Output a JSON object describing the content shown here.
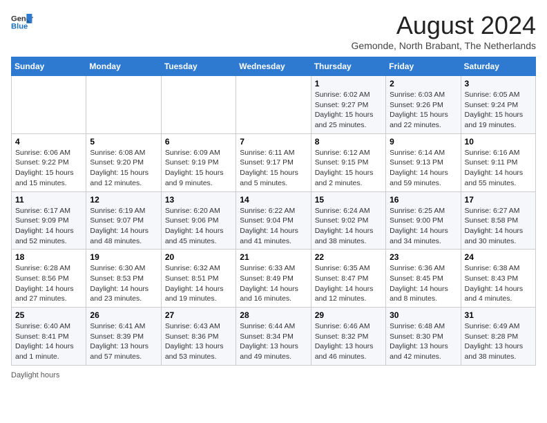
{
  "header": {
    "logo_line1": "General",
    "logo_line2": "Blue",
    "month_year": "August 2024",
    "location": "Gemonde, North Brabant, The Netherlands"
  },
  "weekdays": [
    "Sunday",
    "Monday",
    "Tuesday",
    "Wednesday",
    "Thursday",
    "Friday",
    "Saturday"
  ],
  "footer_text": "Daylight hours",
  "weeks": [
    [
      {
        "day": "",
        "info": ""
      },
      {
        "day": "",
        "info": ""
      },
      {
        "day": "",
        "info": ""
      },
      {
        "day": "",
        "info": ""
      },
      {
        "day": "1",
        "info": "Sunrise: 6:02 AM\nSunset: 9:27 PM\nDaylight: 15 hours\nand 25 minutes."
      },
      {
        "day": "2",
        "info": "Sunrise: 6:03 AM\nSunset: 9:26 PM\nDaylight: 15 hours\nand 22 minutes."
      },
      {
        "day": "3",
        "info": "Sunrise: 6:05 AM\nSunset: 9:24 PM\nDaylight: 15 hours\nand 19 minutes."
      }
    ],
    [
      {
        "day": "4",
        "info": "Sunrise: 6:06 AM\nSunset: 9:22 PM\nDaylight: 15 hours\nand 15 minutes."
      },
      {
        "day": "5",
        "info": "Sunrise: 6:08 AM\nSunset: 9:20 PM\nDaylight: 15 hours\nand 12 minutes."
      },
      {
        "day": "6",
        "info": "Sunrise: 6:09 AM\nSunset: 9:19 PM\nDaylight: 15 hours\nand 9 minutes."
      },
      {
        "day": "7",
        "info": "Sunrise: 6:11 AM\nSunset: 9:17 PM\nDaylight: 15 hours\nand 5 minutes."
      },
      {
        "day": "8",
        "info": "Sunrise: 6:12 AM\nSunset: 9:15 PM\nDaylight: 15 hours\nand 2 minutes."
      },
      {
        "day": "9",
        "info": "Sunrise: 6:14 AM\nSunset: 9:13 PM\nDaylight: 14 hours\nand 59 minutes."
      },
      {
        "day": "10",
        "info": "Sunrise: 6:16 AM\nSunset: 9:11 PM\nDaylight: 14 hours\nand 55 minutes."
      }
    ],
    [
      {
        "day": "11",
        "info": "Sunrise: 6:17 AM\nSunset: 9:09 PM\nDaylight: 14 hours\nand 52 minutes."
      },
      {
        "day": "12",
        "info": "Sunrise: 6:19 AM\nSunset: 9:07 PM\nDaylight: 14 hours\nand 48 minutes."
      },
      {
        "day": "13",
        "info": "Sunrise: 6:20 AM\nSunset: 9:06 PM\nDaylight: 14 hours\nand 45 minutes."
      },
      {
        "day": "14",
        "info": "Sunrise: 6:22 AM\nSunset: 9:04 PM\nDaylight: 14 hours\nand 41 minutes."
      },
      {
        "day": "15",
        "info": "Sunrise: 6:24 AM\nSunset: 9:02 PM\nDaylight: 14 hours\nand 38 minutes."
      },
      {
        "day": "16",
        "info": "Sunrise: 6:25 AM\nSunset: 9:00 PM\nDaylight: 14 hours\nand 34 minutes."
      },
      {
        "day": "17",
        "info": "Sunrise: 6:27 AM\nSunset: 8:58 PM\nDaylight: 14 hours\nand 30 minutes."
      }
    ],
    [
      {
        "day": "18",
        "info": "Sunrise: 6:28 AM\nSunset: 8:56 PM\nDaylight: 14 hours\nand 27 minutes."
      },
      {
        "day": "19",
        "info": "Sunrise: 6:30 AM\nSunset: 8:53 PM\nDaylight: 14 hours\nand 23 minutes."
      },
      {
        "day": "20",
        "info": "Sunrise: 6:32 AM\nSunset: 8:51 PM\nDaylight: 14 hours\nand 19 minutes."
      },
      {
        "day": "21",
        "info": "Sunrise: 6:33 AM\nSunset: 8:49 PM\nDaylight: 14 hours\nand 16 minutes."
      },
      {
        "day": "22",
        "info": "Sunrise: 6:35 AM\nSunset: 8:47 PM\nDaylight: 14 hours\nand 12 minutes."
      },
      {
        "day": "23",
        "info": "Sunrise: 6:36 AM\nSunset: 8:45 PM\nDaylight: 14 hours\nand 8 minutes."
      },
      {
        "day": "24",
        "info": "Sunrise: 6:38 AM\nSunset: 8:43 PM\nDaylight: 14 hours\nand 4 minutes."
      }
    ],
    [
      {
        "day": "25",
        "info": "Sunrise: 6:40 AM\nSunset: 8:41 PM\nDaylight: 14 hours\nand 1 minute."
      },
      {
        "day": "26",
        "info": "Sunrise: 6:41 AM\nSunset: 8:39 PM\nDaylight: 13 hours\nand 57 minutes."
      },
      {
        "day": "27",
        "info": "Sunrise: 6:43 AM\nSunset: 8:36 PM\nDaylight: 13 hours\nand 53 minutes."
      },
      {
        "day": "28",
        "info": "Sunrise: 6:44 AM\nSunset: 8:34 PM\nDaylight: 13 hours\nand 49 minutes."
      },
      {
        "day": "29",
        "info": "Sunrise: 6:46 AM\nSunset: 8:32 PM\nDaylight: 13 hours\nand 46 minutes."
      },
      {
        "day": "30",
        "info": "Sunrise: 6:48 AM\nSunset: 8:30 PM\nDaylight: 13 hours\nand 42 minutes."
      },
      {
        "day": "31",
        "info": "Sunrise: 6:49 AM\nSunset: 8:28 PM\nDaylight: 13 hours\nand 38 minutes."
      }
    ]
  ]
}
